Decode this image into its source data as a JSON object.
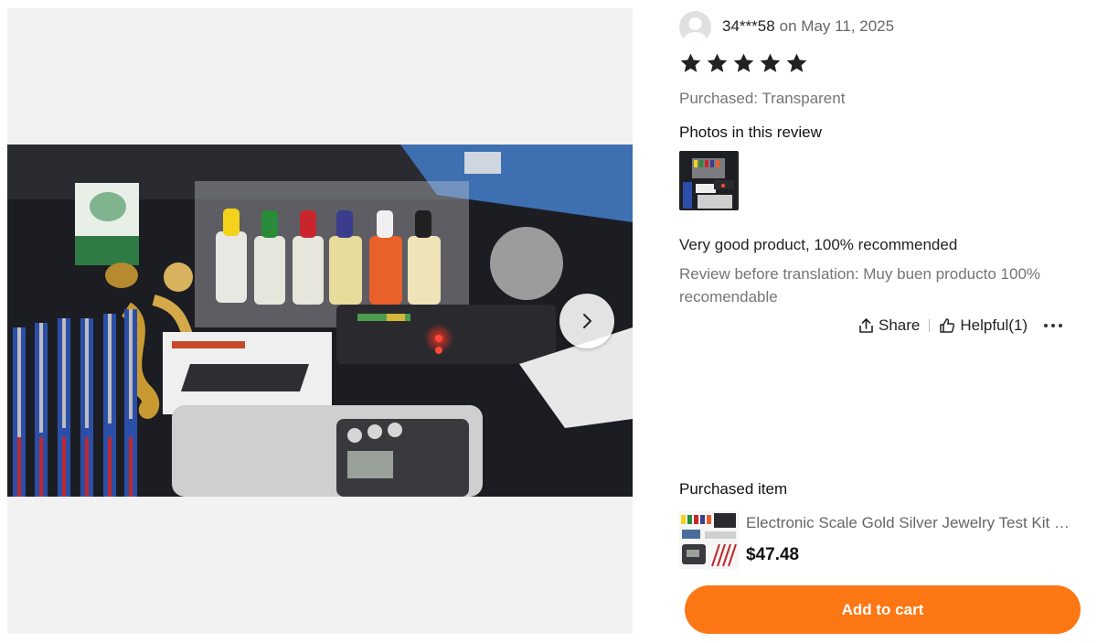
{
  "review": {
    "reviewer": "34***58",
    "date": "on May 11, 2025",
    "rating": 5,
    "purchased_variant": "Purchased: Transparent",
    "photos_title": "Photos in this review",
    "text": "Very good product, 100% recommended",
    "original_text": "Review before translation: Muy buen producto 100% recomendable",
    "actions": {
      "share": "Share",
      "helpful": "Helpful(1)"
    }
  },
  "gallery": {
    "next_icon": "chevron-right-icon"
  },
  "purchased_item": {
    "title": "Purchased item",
    "name": "Electronic Scale Gold Silver Jewelry Test Kit 1...",
    "price": "$47.48"
  },
  "add_to_cart": "Add to cart",
  "colors": {
    "accent": "#fd7714",
    "star": "#222222",
    "muted_text": "#757575"
  }
}
